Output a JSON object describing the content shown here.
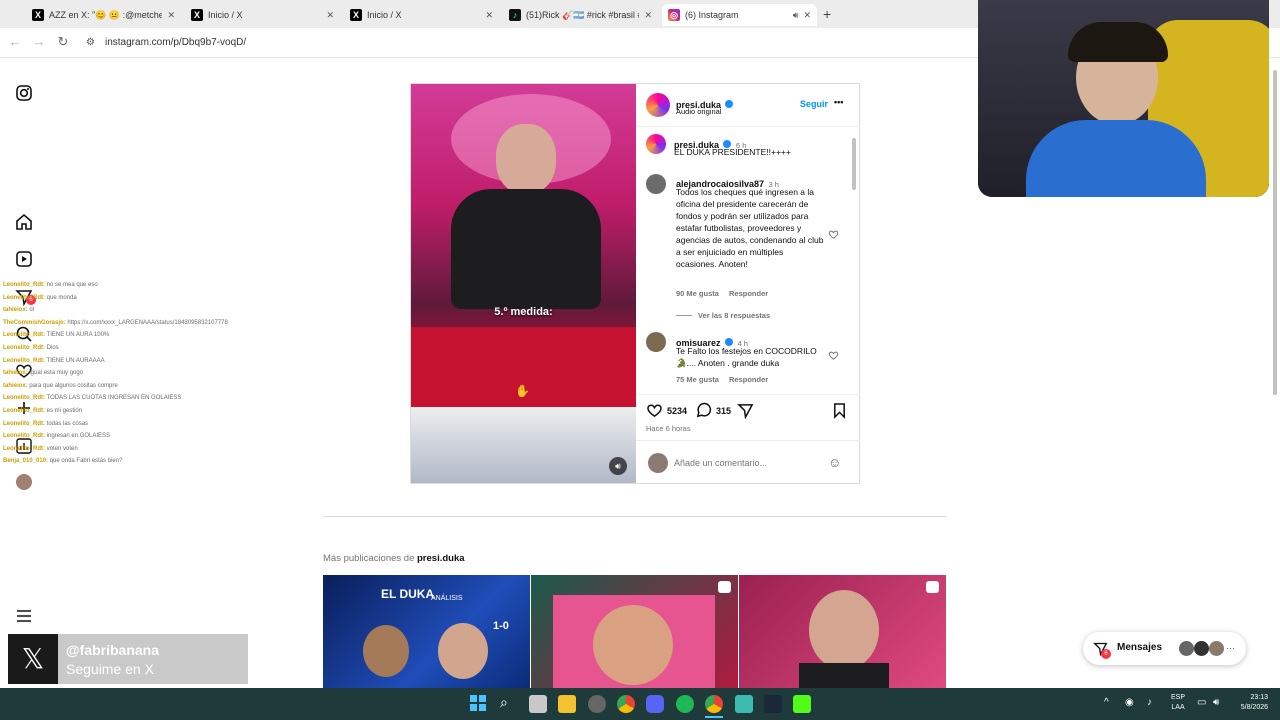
{
  "tabs": [
    {
      "title": "AZZ en X: \"😊 😐 :@metcheve",
      "icon": "x-logo-icon"
    },
    {
      "title": "Inicio / X",
      "icon": "x-logo-icon"
    },
    {
      "title": "Inicio / X",
      "icon": "x-logo-icon"
    },
    {
      "title": "(51)Rick 🎸🇦🇷 #rick #brasil #ta",
      "icon": "tiktok-icon"
    },
    {
      "title": "(6) Instagram",
      "icon": "instagram-icon"
    }
  ],
  "url": "instagram.com/p/Dbq9b7-voqD/",
  "chat": [
    {
      "u": "Leonelito_Rdt:",
      "m": "no se mea que eso"
    },
    {
      "u": "Leonelito_Rdt:",
      "m": "que monda"
    },
    {
      "u": "tahieiox:",
      "m": "ol"
    },
    {
      "u": "TheCommishGorasjo:",
      "m": "https://x.com/xxxx_LARGENAAA/status/1843095832107778"
    },
    {
      "u": "Leonelito_Rdt:",
      "m": "TIENE UN AURA 100%"
    },
    {
      "u": "Leonelito_Rdt:",
      "m": "Dios"
    },
    {
      "u": "Leonelito_Rdt:",
      "m": "TIENE UN AURAAAA"
    },
    {
      "u": "tahieiox:",
      "m": "igual esta muy gogo"
    },
    {
      "u": "tahieiox:",
      "m": "para que algunos cositas compre"
    },
    {
      "u": "Leonelito_Rdt:",
      "m": "TODAS LAS CUOTAS INGRESAN EN GOLAIESS"
    },
    {
      "u": "Leonelito_Rdt:",
      "m": "es mi gestión"
    },
    {
      "u": "Leonelito_Rdt:",
      "m": "todas las cosas"
    },
    {
      "u": "Leonelito_Rdt:",
      "m": "ingresan en GOLAIESS"
    },
    {
      "u": "Leonelito_Rdt:",
      "m": "voten voten"
    },
    {
      "u": "Benja_010_010:",
      "m": "que onda Fabri estás bien?"
    }
  ],
  "post": {
    "author": "presi.duka",
    "audio": "Audio original",
    "follow": "Seguir",
    "more": "•••",
    "video_caption": "5.º medida:",
    "caption_user": "presi.duka",
    "caption_time": "6 h",
    "caption_text": "EL DUKA PRESIDENTE!!++++",
    "comments": [
      {
        "user": "alejandrocaiosilva87",
        "time": "3 h",
        "text": "Todos los cheques qué ingresen a la oficina del presidente carecerán de fondos y podrán ser utilizados para estafar futbolistas, proveedores y agencias de autos, condenando al club a ser enjuiciado en múltiples ocasiones. Anoten!",
        "likes": "90 Me gusta",
        "reply": "Responder",
        "replies": "Ver las 8 respuestas"
      },
      {
        "user": "omisuarez",
        "time": "4 h",
        "text": "Te Falto los festejos en COCODRILO 🐊.... Anoten . grande duka",
        "likes": "75 Me gusta",
        "reply": "Responder"
      }
    ],
    "likes": "5234",
    "comments_count": "315",
    "posted": "Hace 6 horas",
    "comment_placeholder": "Añade un comentario..."
  },
  "more_posts": {
    "prefix": "Más publicaciones de ",
    "user": "presi.duka"
  },
  "thumb1": {
    "title": "EL DUKA",
    "tag": "ANÁLISIS",
    "score": "1-0"
  },
  "x_promo": {
    "handle": "@fabribanana",
    "cta": "Seguime en X"
  },
  "messages": {
    "label": "Mensajes",
    "badge": "6",
    "more": "···"
  },
  "taskbar": {
    "lang1": "ESP",
    "lang2": "LAA",
    "time": "23:13",
    "date": "5/8/2026"
  }
}
